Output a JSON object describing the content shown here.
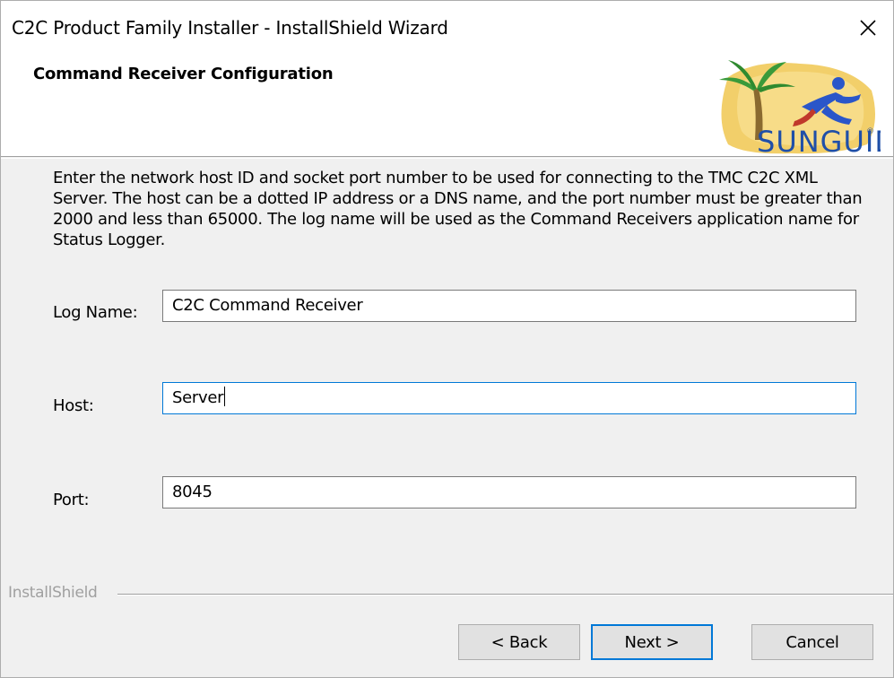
{
  "window": {
    "title": "C2C Product Family Installer - InstallShield Wizard",
    "close_icon": "close-icon"
  },
  "header": {
    "title": "Command Receiver Configuration",
    "logo_text": "SUNGUIDE",
    "logo_mark": "®"
  },
  "description": "Enter the network host ID and socket port number to be used for connecting to the TMC C2C XML Server.  The host can be a dotted IP address or a DNS name, and the port number must be greater than 2000 and less than 65000. The log name will be used as the Command Receivers application name for Status Logger.",
  "fields": {
    "log_name": {
      "label": "Log Name:",
      "value": "C2C Command Receiver"
    },
    "host": {
      "label": "Host:",
      "value": "Server"
    },
    "port": {
      "label": "Port:",
      "value": "8045"
    }
  },
  "footer": {
    "brand": "InstallShield",
    "back_label": "< Back",
    "next_label": "Next >",
    "cancel_label": "Cancel"
  },
  "colors": {
    "accent": "#0078d7",
    "dialog_bg": "#f0f0f0",
    "button_bg": "#e1e1e1",
    "logo_sun": "#f2cf6a",
    "logo_palm": "#3a9a3a",
    "logo_figure": "#2a56c9",
    "logo_text": "#1f4fa8"
  }
}
